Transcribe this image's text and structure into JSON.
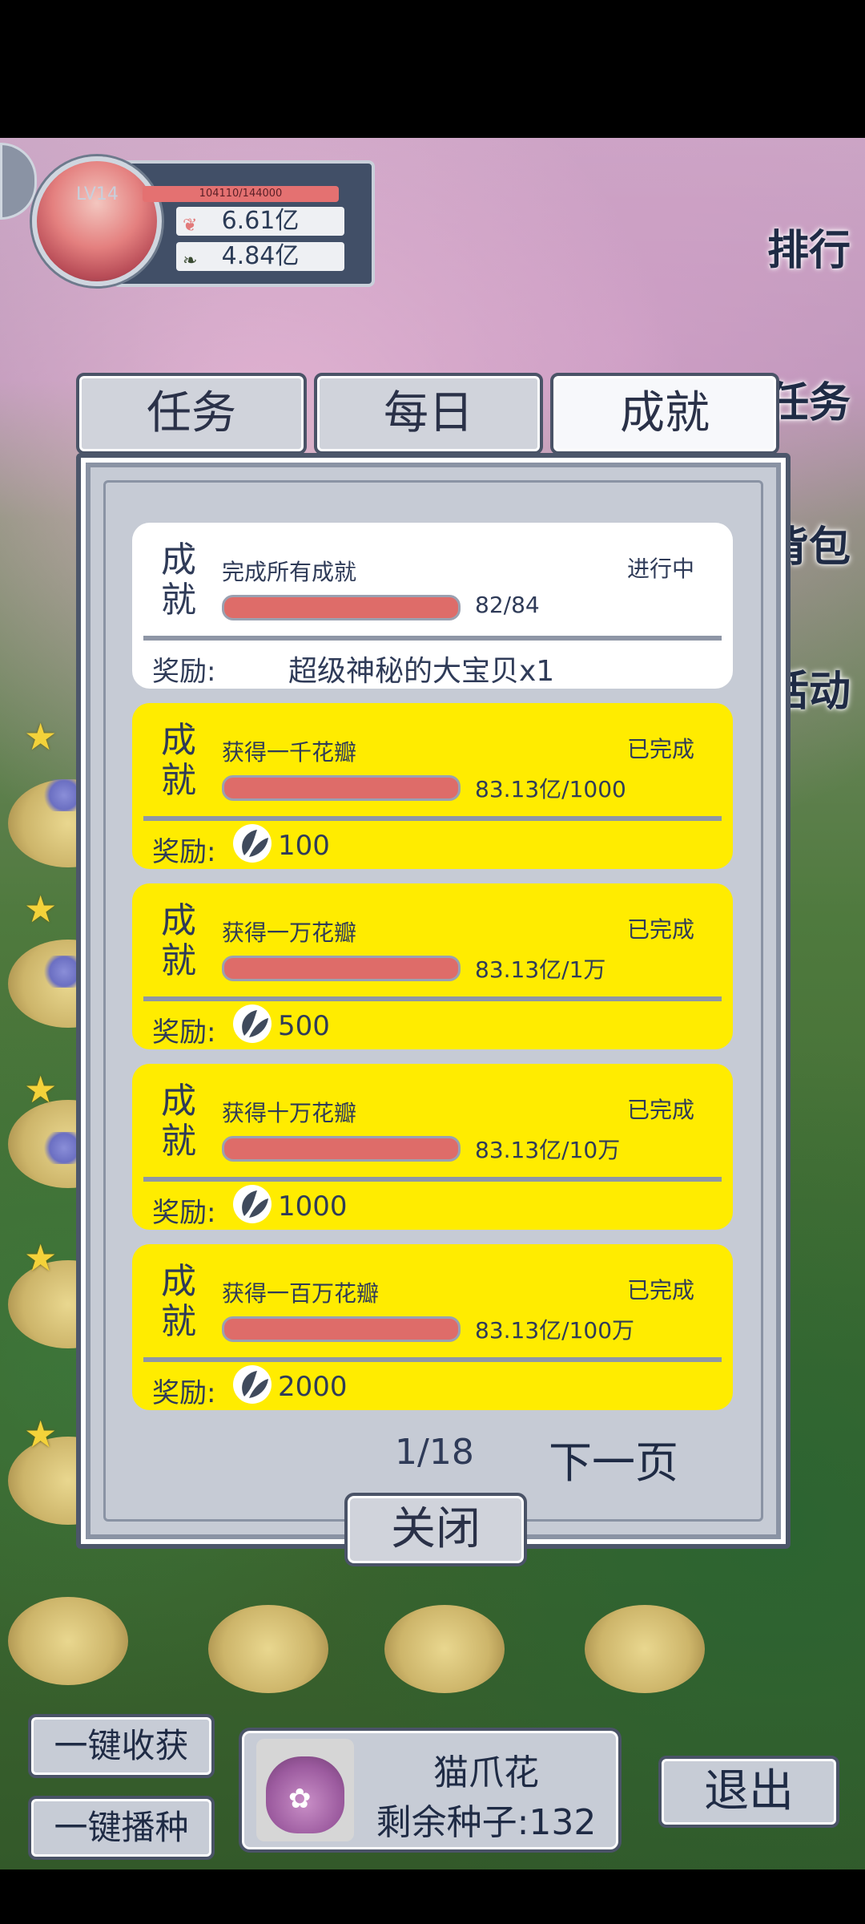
{
  "player": {
    "level": "LV14",
    "xp": "104110/144000",
    "petals_total": "6.61亿",
    "leaves_total": "4.84亿"
  },
  "side_menu": [
    "排行",
    "任务",
    "背包",
    "活动"
  ],
  "tabs": [
    {
      "label": "任务",
      "active": false
    },
    {
      "label": "每日",
      "active": false
    },
    {
      "label": "成就",
      "active": true
    }
  ],
  "achievements": [
    {
      "kind": "成\n就",
      "name": "完成所有成就",
      "state": "进行中",
      "progress": "82/84",
      "reward_label": "奖励:",
      "reward": "超级神秘的大宝贝x1",
      "style": "white"
    },
    {
      "kind": "成\n就",
      "name": "获得一千花瓣",
      "state": "已完成",
      "progress": "83.13亿/1000",
      "reward_label": "奖励:",
      "reward": "100",
      "style": "yellow",
      "reward_icon": "petal-icon"
    },
    {
      "kind": "成\n就",
      "name": "获得一万花瓣",
      "state": "已完成",
      "progress": "83.13亿/1万",
      "reward_label": "奖励:",
      "reward": "500",
      "style": "yellow",
      "reward_icon": "petal-icon"
    },
    {
      "kind": "成\n就",
      "name": "获得十万花瓣",
      "state": "已完成",
      "progress": "83.13亿/10万",
      "reward_label": "奖励:",
      "reward": "1000",
      "style": "yellow",
      "reward_icon": "petal-icon"
    },
    {
      "kind": "成\n就",
      "name": "获得一百万花瓣",
      "state": "已完成",
      "progress": "83.13亿/100万",
      "reward_label": "奖励:",
      "reward": "2000",
      "style": "yellow",
      "reward_icon": "petal-icon"
    }
  ],
  "pager": {
    "page": "1/18",
    "next_label": "下一页"
  },
  "close_label": "关闭",
  "bottom": {
    "harvest_all": "一键收获",
    "sow_all": "一键播种",
    "seed_name": "猫爪花",
    "seed_remaining": "剩余种子:132",
    "exit": "退出"
  },
  "colors": {
    "card_done": "#ffec00",
    "card_active": "#ffffff",
    "progress_fill": "#de6c69",
    "text": "#2f3b58"
  }
}
